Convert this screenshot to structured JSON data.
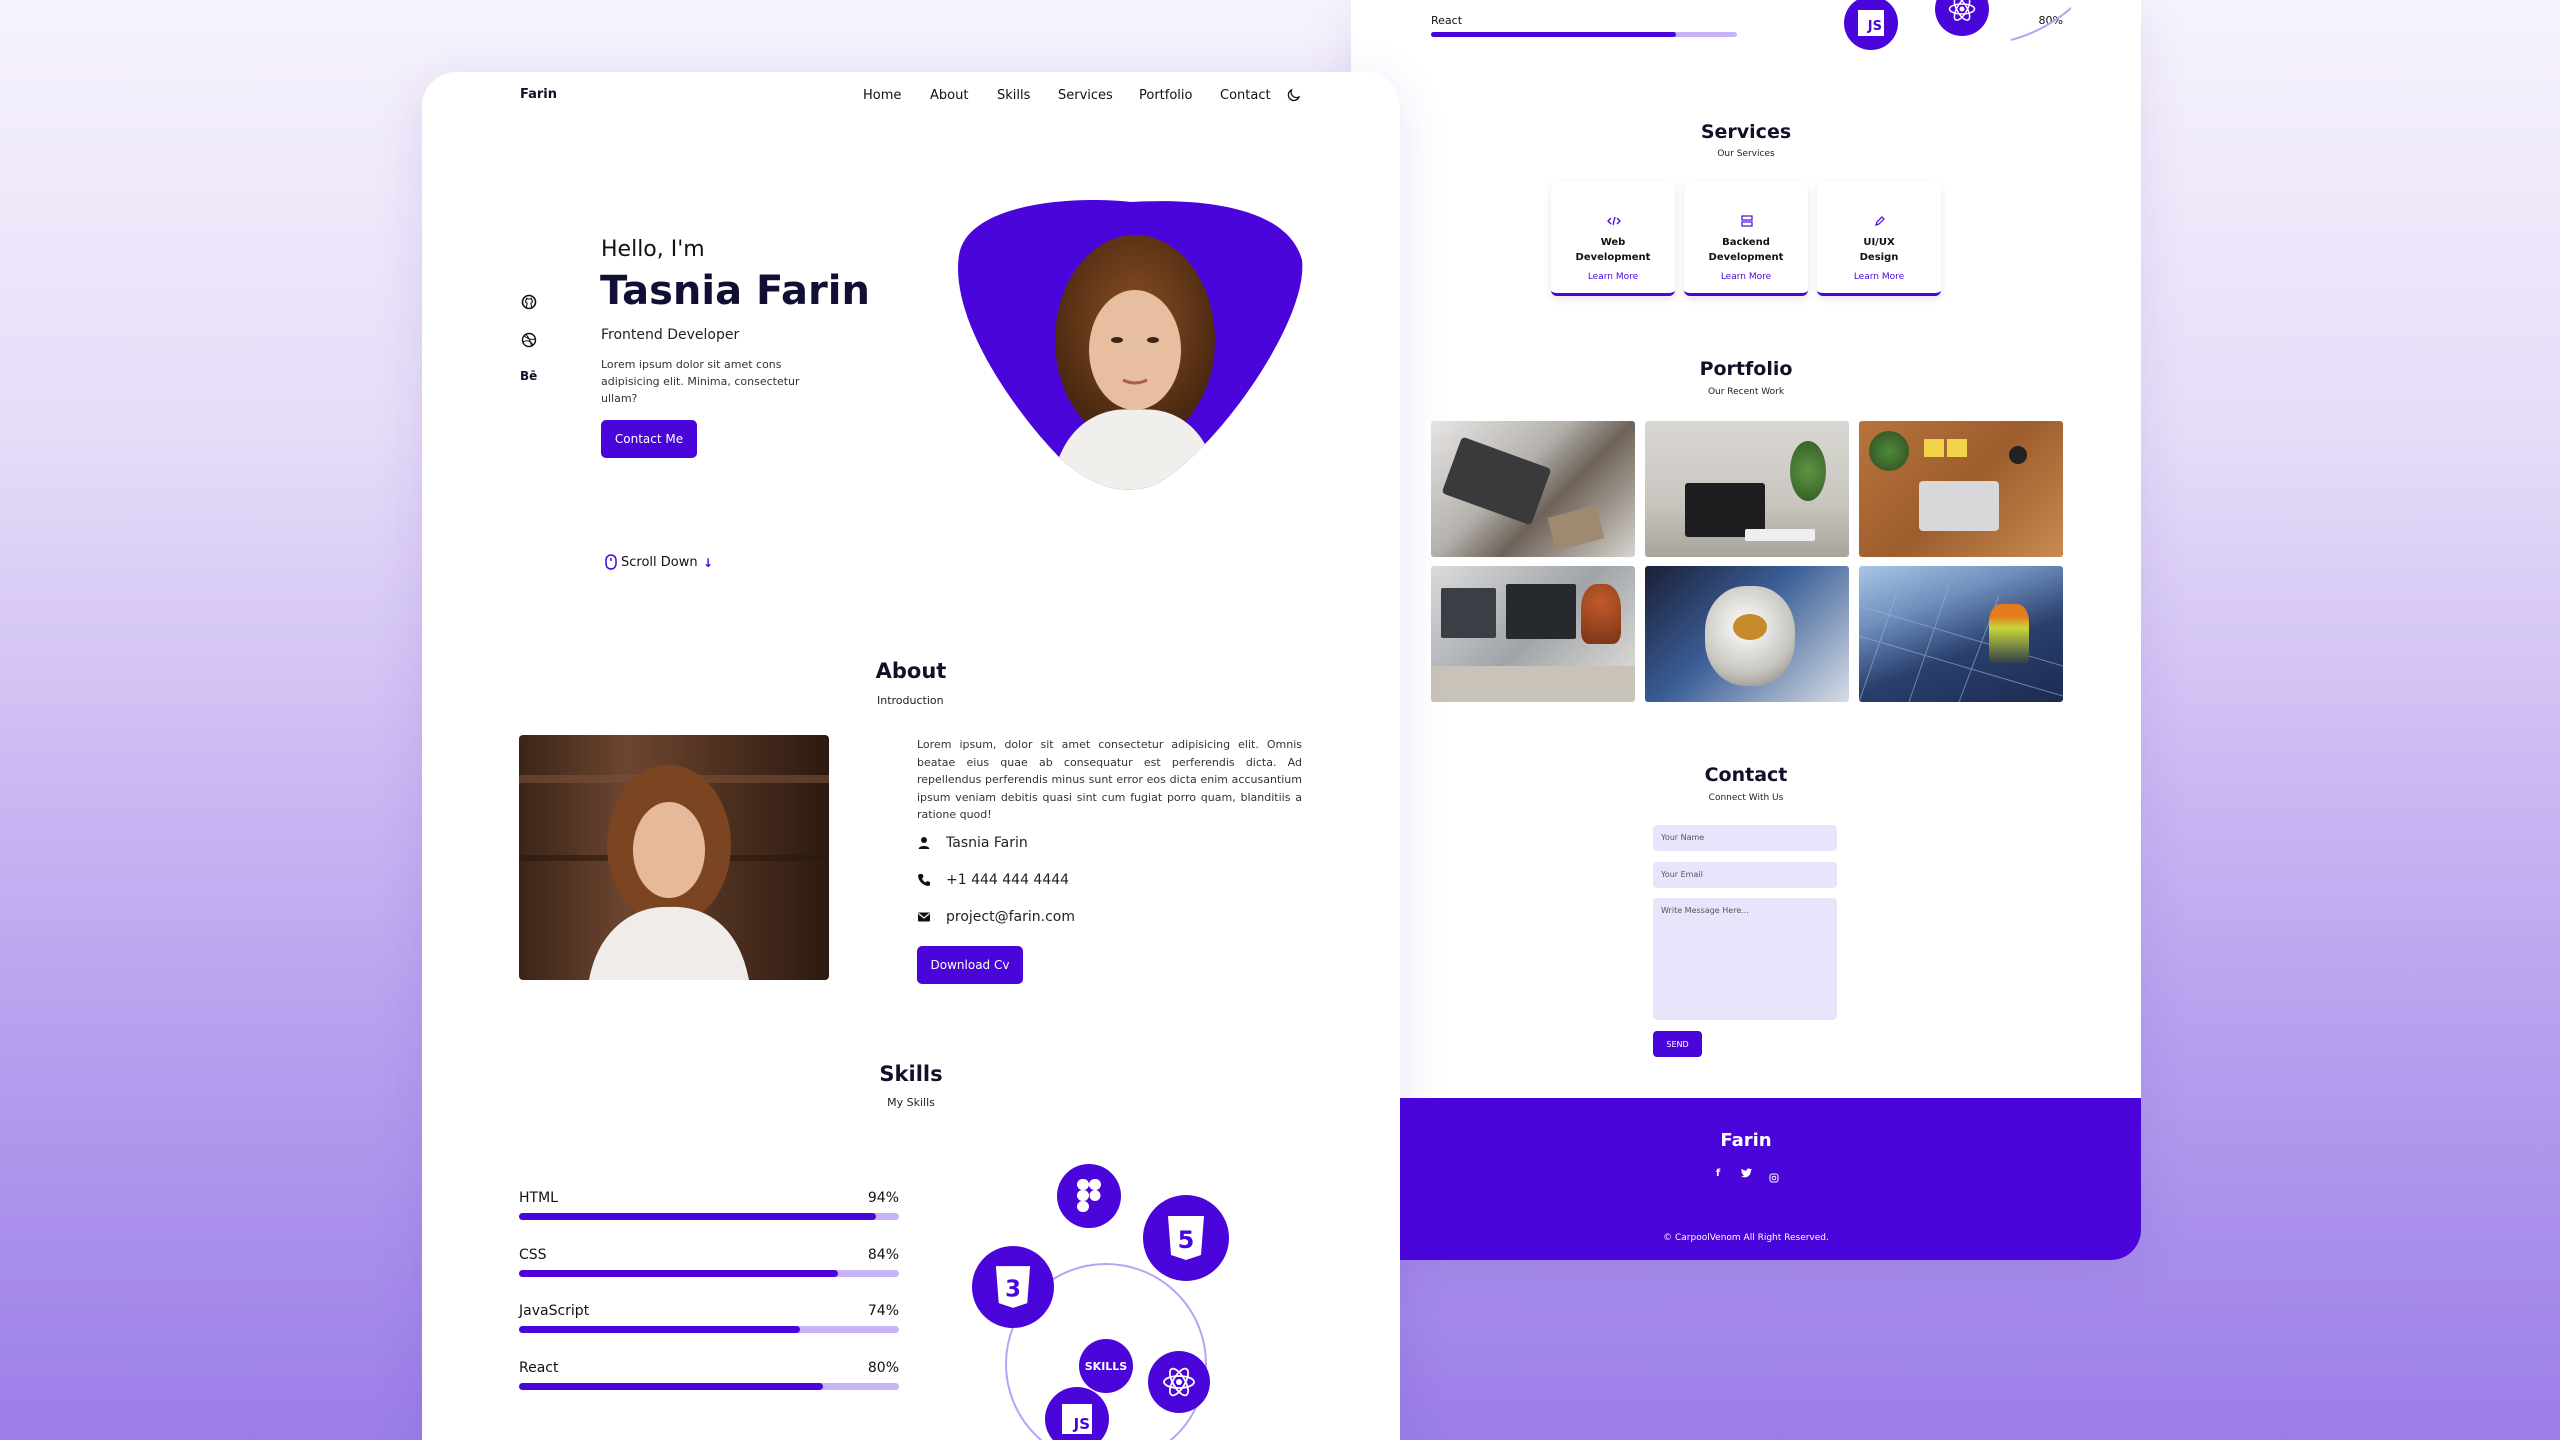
{
  "brand": "Farin",
  "nav": {
    "links": [
      "Home",
      "About",
      "Skills",
      "Services",
      "Portfolio",
      "Contact"
    ]
  },
  "hero": {
    "greeting": "Hello, I'm",
    "name": "Tasnia Farin",
    "role": "Frontend Developer",
    "text": "Lorem ipsum dolor sit amet cons adipisicing elit. Minima, consectetur ullam?",
    "button": "Contact Me",
    "scroll": "Scroll Down",
    "social_icons": [
      "github-icon",
      "dribbble-icon",
      "behance-icon"
    ],
    "behance_text": "Bē"
  },
  "about": {
    "title": "About",
    "subtitle": "Introduction",
    "text": "Lorem ipsum, dolor sit amet consectetur adipisicing elit. Omnis beatae eius quae ab consequatur est perferendis dicta. Ad repellendus perferendis minus sunt error eos dicta enim accusantium ipsum veniam debitis quasi sint cum fugiat porro quam, blanditiis a ratione quod!",
    "person": "Tasnia Farin",
    "phone": "+1 444 444 4444",
    "email": "project@farin.com",
    "button": "Download Cv"
  },
  "skills": {
    "title": "Skills",
    "subtitle": "My Skills",
    "center": "SKILLS",
    "items": [
      {
        "name": "HTML",
        "percent": 94,
        "label": "94%"
      },
      {
        "name": "CSS",
        "percent": 84,
        "label": "84%"
      },
      {
        "name": "JavaScript",
        "percent": 74,
        "label": "74%"
      },
      {
        "name": "React",
        "percent": 80,
        "label": "80%"
      }
    ],
    "icons": [
      "figma-icon",
      "html5-icon",
      "css3-icon",
      "javascript-icon",
      "react-icon"
    ],
    "html_text": "5",
    "css_text": "3",
    "js_text": "JS"
  },
  "back_skill": {
    "name": "React",
    "percent": 80,
    "label": "80%"
  },
  "services": {
    "title": "Services",
    "subtitle": "Our Services",
    "items": [
      {
        "line1": "Web",
        "line2": "Development",
        "link": "Learn More",
        "icon": "code-icon"
      },
      {
        "line1": "Backend",
        "line2": "Development",
        "link": "Learn More",
        "icon": "server-icon"
      },
      {
        "line1": "UI/UX",
        "line2": "Design",
        "link": "Learn More",
        "icon": "pen-icon"
      }
    ]
  },
  "portfolio": {
    "title": "Portfolio",
    "subtitle": "Our Recent Work",
    "photos": [
      "laptop-desk-photo",
      "desk-plant-photo",
      "wood-desk-photo",
      "woman-coding-photo",
      "astronaut-photo",
      "solar-panels-photo"
    ]
  },
  "contact": {
    "title": "Contact",
    "subtitle": "Connect With Us",
    "name_placeholder": "Your Name",
    "email_placeholder": "Your Email",
    "message_placeholder": "Write Message Here...",
    "button": "SEND"
  },
  "footer": {
    "brand": "Farin",
    "social_icons": [
      "facebook-icon",
      "twitter-icon",
      "instagram-icon"
    ],
    "facebook_text": "f",
    "twitter_text": "🐦",
    "instagram_text": "◎",
    "copyright": "© CarpoolVenom All Right Reserved."
  },
  "colors": {
    "accent": "#4a05db",
    "track": "#c7b4f6",
    "field": "#eae3fc"
  }
}
